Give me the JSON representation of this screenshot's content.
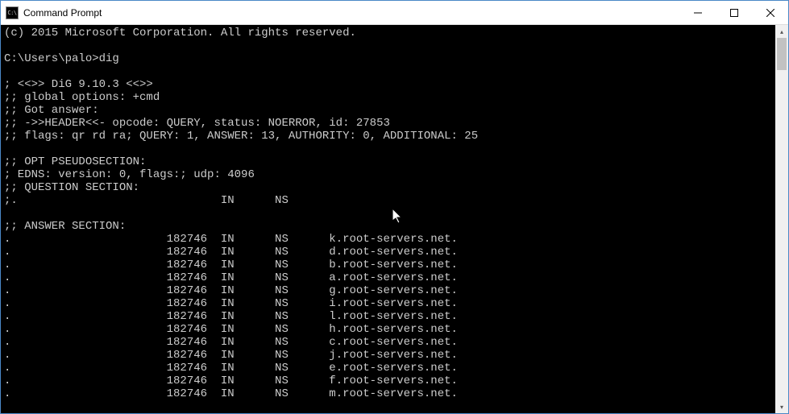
{
  "window": {
    "title": "Command Prompt",
    "icon_label": "C:\\"
  },
  "terminal": {
    "copyright": "(c) 2015 Microsoft Corporation. All rights reserved.",
    "prompt": "C:\\Users\\palo>",
    "command": "dig",
    "dig_header": "; <<>> DiG 9.10.3 <<>>",
    "global_options": ";; global options: +cmd",
    "got_answer": ";; Got answer:",
    "header_line": ";; ->>HEADER<<- opcode: QUERY, status: NOERROR, id: 27853",
    "flags_line": ";; flags: qr rd ra; QUERY: 1, ANSWER: 13, AUTHORITY: 0, ADDITIONAL: 25",
    "opt_pseudo": ";; OPT PSEUDOSECTION:",
    "edns_line": "; EDNS: version: 0, flags:; udp: 4096",
    "question_section": ";; QUESTION SECTION:",
    "question_row": ";.                              IN      NS",
    "answer_section": ";; ANSWER SECTION:",
    "answers": [
      {
        "name": ".",
        "ttl": "182746",
        "class": "IN",
        "type": "NS",
        "value": "k.root-servers.net."
      },
      {
        "name": ".",
        "ttl": "182746",
        "class": "IN",
        "type": "NS",
        "value": "d.root-servers.net."
      },
      {
        "name": ".",
        "ttl": "182746",
        "class": "IN",
        "type": "NS",
        "value": "b.root-servers.net."
      },
      {
        "name": ".",
        "ttl": "182746",
        "class": "IN",
        "type": "NS",
        "value": "a.root-servers.net."
      },
      {
        "name": ".",
        "ttl": "182746",
        "class": "IN",
        "type": "NS",
        "value": "g.root-servers.net."
      },
      {
        "name": ".",
        "ttl": "182746",
        "class": "IN",
        "type": "NS",
        "value": "i.root-servers.net."
      },
      {
        "name": ".",
        "ttl": "182746",
        "class": "IN",
        "type": "NS",
        "value": "l.root-servers.net."
      },
      {
        "name": ".",
        "ttl": "182746",
        "class": "IN",
        "type": "NS",
        "value": "h.root-servers.net."
      },
      {
        "name": ".",
        "ttl": "182746",
        "class": "IN",
        "type": "NS",
        "value": "c.root-servers.net."
      },
      {
        "name": ".",
        "ttl": "182746",
        "class": "IN",
        "type": "NS",
        "value": "j.root-servers.net."
      },
      {
        "name": ".",
        "ttl": "182746",
        "class": "IN",
        "type": "NS",
        "value": "e.root-servers.net."
      },
      {
        "name": ".",
        "ttl": "182746",
        "class": "IN",
        "type": "NS",
        "value": "f.root-servers.net."
      },
      {
        "name": ".",
        "ttl": "182746",
        "class": "IN",
        "type": "NS",
        "value": "m.root-servers.net."
      }
    ]
  }
}
